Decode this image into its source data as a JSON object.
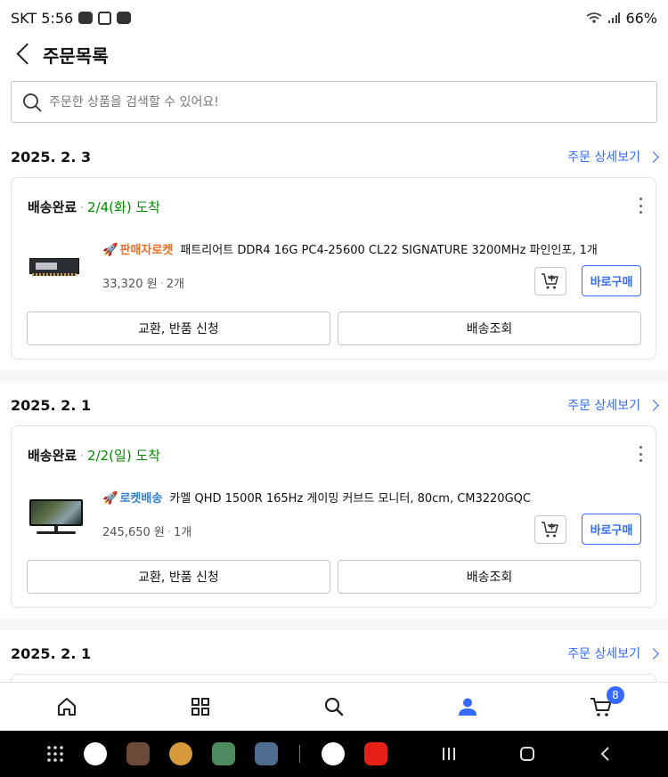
{
  "status_bar": {
    "carrier_time": "SKT 5:56",
    "battery": "66%",
    "icons": [
      "talk-icon",
      "message-icon",
      "gesture-icon",
      "wifi-icon",
      "signal-icon"
    ]
  },
  "header": {
    "title": "주문목록"
  },
  "search": {
    "placeholder": "주문한 상품을 검색할 수 있어요!"
  },
  "orders": [
    {
      "date": "2025. 2. 3",
      "detail_label": "주문 상세보기",
      "status": "배송완료",
      "arrival": "2/4(화) 도착",
      "badge": "판매자로켓",
      "product_name": "패트리어트 DDR4 16G PC4-25600 CL22 SIGNATURE 3200MHz 파인인포, 1개",
      "price": "33,320 원",
      "quantity": "2개",
      "buy_label": "바로구매",
      "exchange_label": "교환, 반품 신청",
      "tracking_label": "배송조회"
    },
    {
      "date": "2025. 2. 1",
      "detail_label": "주문 상세보기",
      "status": "배송완료",
      "arrival": "2/2(일) 도착",
      "badge": "로켓배송",
      "product_name": "카멜 QHD 1500R 165Hz 게이밍 커브드 모니터, 80cm, CM3220GQC",
      "price": "245,650 원",
      "quantity": "1개",
      "buy_label": "바로구매",
      "exchange_label": "교환, 반품 신청",
      "tracking_label": "배송조회"
    },
    {
      "date": "2025. 2. 1",
      "detail_label": "주문 상세보기"
    }
  ],
  "bottom_nav": {
    "items": [
      "home-icon",
      "category-icon",
      "search-icon",
      "my-icon",
      "cart-icon"
    ],
    "active": "my-icon",
    "cart_count": "8",
    "accent": "#346aff"
  },
  "colors": {
    "accent": "#346aff",
    "arrival_green": "#008c00",
    "seller_rocket": "#f26b21",
    "rocket_delivery": "#2f80d1"
  }
}
